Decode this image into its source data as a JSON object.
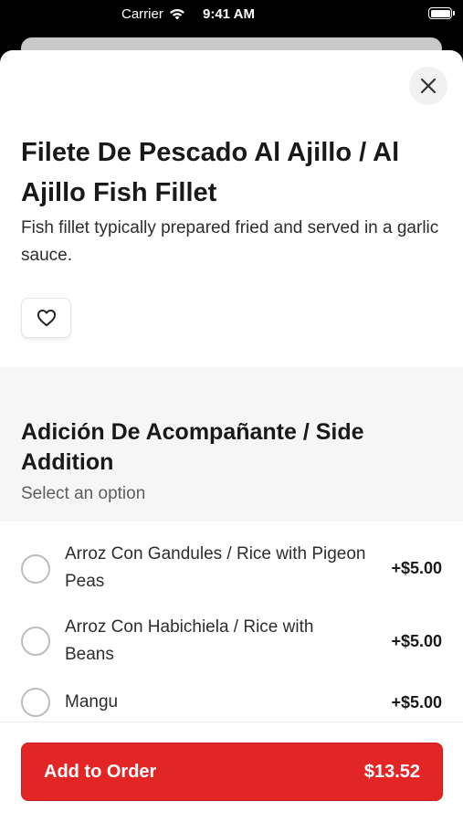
{
  "status_bar": {
    "carrier": "Carrier",
    "time": "9:41 AM"
  },
  "item": {
    "title": "Filete De Pescado Al Ajillo / Al Ajillo Fish Fillet",
    "description": "Fish fillet typically prepared fried and served in a garlic sauce."
  },
  "modifier_group": {
    "title": "Adición De Acompañante / Side Addition",
    "subtitle": "Select an option",
    "options": [
      {
        "label": "Arroz Con Gandules / Rice with Pigeon Peas",
        "price": "+$5.00"
      },
      {
        "label": "Arroz Con Habichiela / Rice with Beans",
        "price": "+$5.00"
      },
      {
        "label": "Mangu",
        "price": "+$5.00"
      }
    ]
  },
  "footer": {
    "add_label": "Add to Order",
    "total": "$13.52"
  },
  "colors": {
    "accent": "#e42526",
    "section_bg": "#f6f6f6"
  },
  "icons": {
    "close": "close-icon",
    "favorite": "heart-icon",
    "wifi": "wifi-icon",
    "battery": "battery-icon"
  }
}
